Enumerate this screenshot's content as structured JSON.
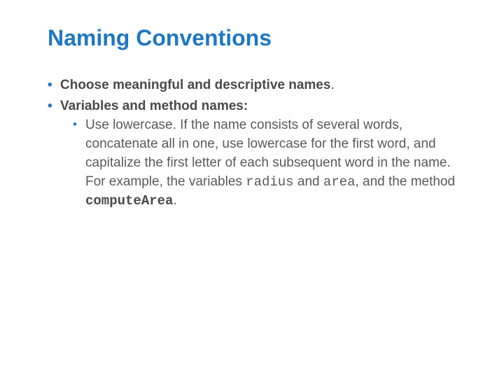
{
  "title": "Naming Conventions",
  "bullets": {
    "b1": "Choose meaningful and descriptive names",
    "b1_tail": ".",
    "b2": "Variables and method names:",
    "sub_pre": "Use lowercase. If the name consists of several words, concatenate all in one, use lowercase for the first word, and capitalize the first letter of each subsequent word in the name. For example, the variables ",
    "code1": "radius",
    "sub_mid1": " and ",
    "code2": "area",
    "sub_mid2": ", and the method ",
    "code3": "computeArea",
    "sub_tail": "."
  }
}
